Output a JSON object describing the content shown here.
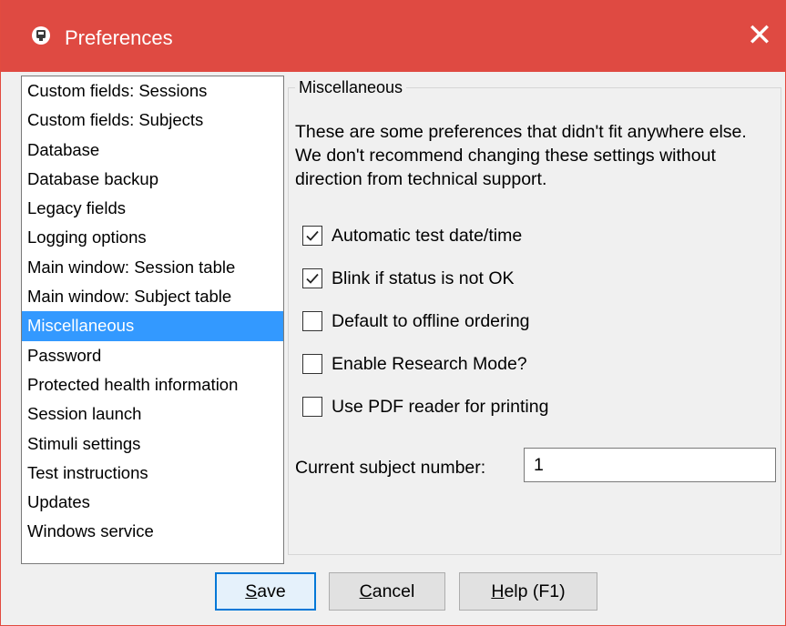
{
  "window": {
    "title": "Preferences",
    "close_glyph": "✕",
    "title_bar_color": "#df4a42"
  },
  "categories": {
    "selected": "Miscellaneous",
    "items": [
      "Custom fields: Sessions",
      "Custom fields: Subjects",
      "Database",
      "Database backup",
      "Legacy fields",
      "Logging options",
      "Main window: Session table",
      "Main window: Subject table",
      "Miscellaneous",
      "Password",
      "Protected health information",
      "Session launch",
      "Stimuli settings",
      "Test instructions",
      "Updates",
      "Windows service"
    ]
  },
  "panel": {
    "group_title": "Miscellaneous",
    "description": "These are some preferences that didn't fit anywhere else. We don't recommend changing these settings without direction from technical support.",
    "options": [
      {
        "label": "Automatic test date/time",
        "checked": true
      },
      {
        "label": "Blink if status is not OK",
        "checked": true
      },
      {
        "label": "Default to offline ordering",
        "checked": false
      },
      {
        "label": "Enable Research Mode?",
        "checked": false
      },
      {
        "label": "Use PDF reader for printing",
        "checked": false
      }
    ],
    "subject_number_label": "Current subject number:",
    "subject_number_value": "1"
  },
  "buttons": {
    "save": {
      "mnemonic": "S",
      "rest": "ave"
    },
    "cancel": {
      "mnemonic": "C",
      "rest": "ancel"
    },
    "help": {
      "mnemonic": "H",
      "rest": "elp (F1)"
    }
  },
  "colors": {
    "selection": "#3399ff",
    "default_button_border": "#0078d7"
  }
}
